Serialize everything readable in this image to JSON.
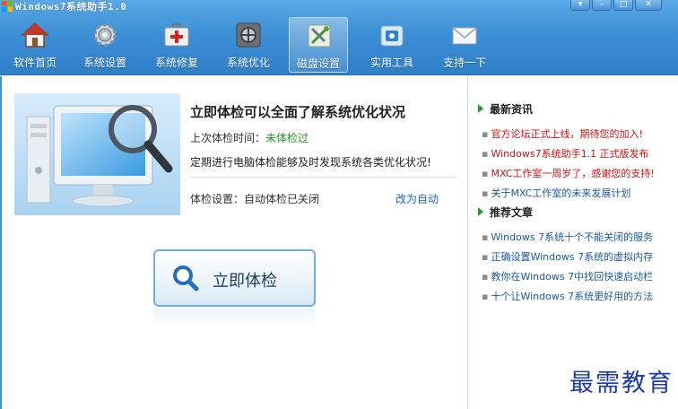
{
  "window": {
    "title": "Windows7系统助手1.0"
  },
  "nav": [
    {
      "label": "软件首页",
      "icon": "home-icon"
    },
    {
      "label": "系统设置",
      "icon": "gear-icon"
    },
    {
      "label": "系统修复",
      "icon": "first-aid-kit-icon"
    },
    {
      "label": "系统优化",
      "icon": "optimize-icon"
    },
    {
      "label": "磁盘设置",
      "icon": "disk-tools-icon"
    },
    {
      "label": "实用工具",
      "icon": "toolbox-icon"
    },
    {
      "label": "支持一下",
      "icon": "mail-icon"
    }
  ],
  "active_nav": "磁盘设置",
  "checkup": {
    "title": "立即体检可以全面了解系统优化状况",
    "last_check_label": "上次体检时间：",
    "last_check_value": "未体检过",
    "advice": "定期进行电脑体检能够及时发现系统各类优化状况!",
    "setting": "体检设置：自动体检已关闭",
    "change_link": "改为自动",
    "button_label": "立即体检"
  },
  "news": {
    "heading": "最新资讯",
    "items": [
      {
        "text": "官方论坛正式上线，期待您的加入!",
        "color": "red"
      },
      {
        "text": "Windows7系统助手1.1 正式版发布",
        "color": "red"
      },
      {
        "text": "MXC工作室一周岁了，感谢您的支持!",
        "color": "red"
      },
      {
        "text": "关于MXC工作室的未来发展计划",
        "color": "blue"
      }
    ]
  },
  "articles": {
    "heading": "推荐文章",
    "items": [
      "Windows 7系统十个不能关闭的服务",
      "正确设置Windows 7系统的虚拟内存",
      "教你在Windows 7中找回快速启动栏",
      "十个让Windows 7系统更好用的方法"
    ]
  },
  "watermark": "最需教育",
  "colors": {
    "accent": "#3d8fd6",
    "link_red": "#cc1010",
    "link_blue": "#1a5aa8",
    "ok_green": "#1e9d2a"
  }
}
